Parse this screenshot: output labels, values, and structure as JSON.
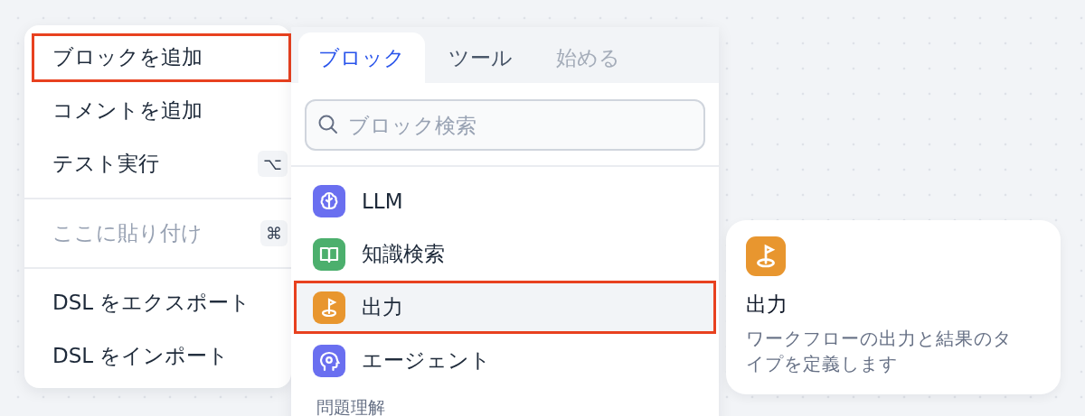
{
  "context_menu": {
    "groups": [
      [
        {
          "label": "ブロックを追加",
          "highlighted": true,
          "disabled": false
        },
        {
          "label": "コメントを追加",
          "highlighted": false,
          "disabled": false
        },
        {
          "label": "テスト実行",
          "shortcut": "⌥",
          "highlighted": false,
          "disabled": false
        }
      ],
      [
        {
          "label": "ここに貼り付け",
          "shortcut": "⌘",
          "highlighted": false,
          "disabled": true
        }
      ],
      [
        {
          "label": "DSL をエクスポート",
          "highlighted": false,
          "disabled": false
        },
        {
          "label": "DSL をインポート",
          "highlighted": false,
          "disabled": false
        }
      ]
    ]
  },
  "block_panel": {
    "tabs": [
      {
        "label": "ブロック",
        "selected": true,
        "disabled": false
      },
      {
        "label": "ツール",
        "selected": false,
        "disabled": false
      },
      {
        "label": "始める",
        "selected": false,
        "disabled": true
      }
    ],
    "search": {
      "placeholder": "ブロック検索"
    },
    "items": [
      {
        "label": "LLM",
        "kind": "brain",
        "color": "#6a6ff0",
        "selected": false,
        "highlighted": false
      },
      {
        "label": "知識検索",
        "kind": "book",
        "color": "#4caf6d",
        "selected": false,
        "highlighted": false
      },
      {
        "label": "出力",
        "kind": "flag",
        "color": "#e8962f",
        "selected": true,
        "highlighted": true
      },
      {
        "label": "エージェント",
        "kind": "agent",
        "color": "#6a6ff0",
        "selected": false,
        "highlighted": false
      }
    ],
    "section_label": "問題理解"
  },
  "tooltip": {
    "kind": "flag",
    "color": "#e8962f",
    "title": "出力",
    "description": "ワークフローの出力と結果のタイプを定義します"
  }
}
